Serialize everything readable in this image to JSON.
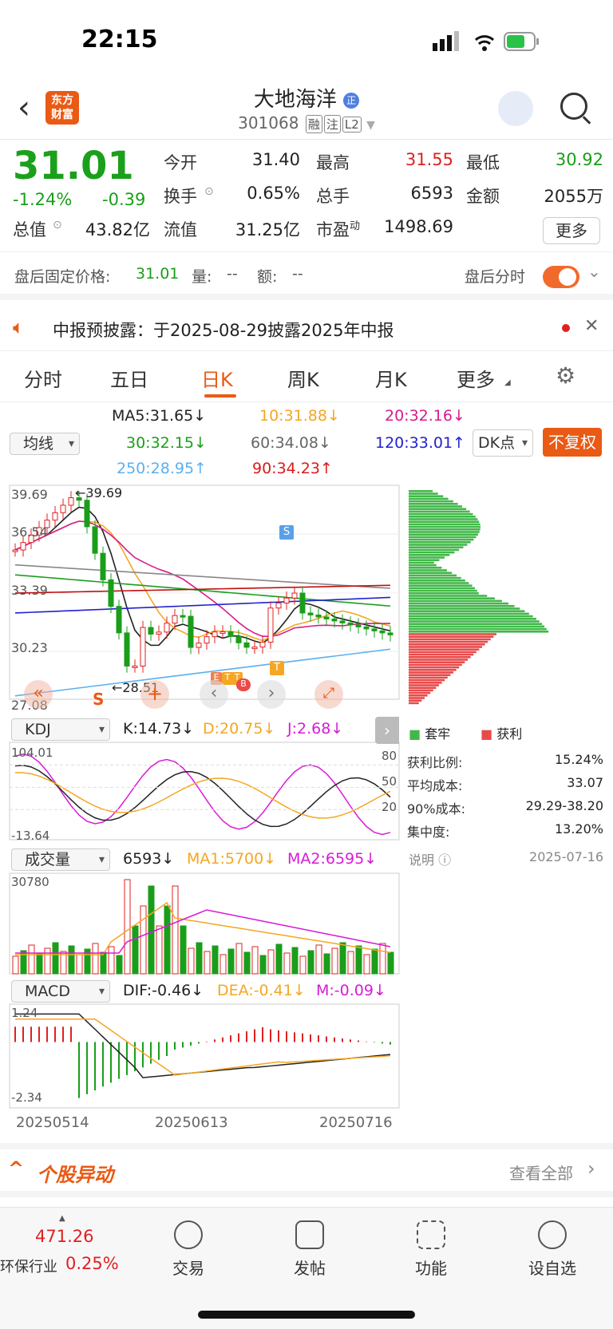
{
  "status": {
    "time": "22:15"
  },
  "header": {
    "logo_text": "东方\n财富",
    "stock_name": "大地海洋",
    "name_badge": "正",
    "code": "301068",
    "tags": [
      "融",
      "注",
      "L2"
    ]
  },
  "quote": {
    "price": "31.01",
    "change_pct": "-1.24%",
    "change": "-0.39",
    "open_label": "今开",
    "open": "31.40",
    "high_label": "最高",
    "high": "31.55",
    "low_label": "最低",
    "low": "30.92",
    "turnover_label": "换手",
    "turnover": "0.65%",
    "volume_label": "总手",
    "volume": "6593",
    "amount_label": "金额",
    "amount": "2055万",
    "mktcap_label": "总值",
    "mktcap": "43.82亿",
    "float_label": "流值",
    "float": "31.25亿",
    "pe_label": "市盈",
    "pe_sup": "动",
    "pe": "1498.69",
    "more_label": "更多"
  },
  "after_hours": {
    "fixed_label": "盘后固定价格:",
    "fixed_value": "31.01",
    "vol_label": "量:",
    "vol_value": "--",
    "amt_label": "额:",
    "amt_value": "--",
    "switch_label": "盘后分时"
  },
  "notice": {
    "text": "中报预披露：于2025-08-29披露2025年中报"
  },
  "tabs": [
    "分时",
    "五日",
    "日K",
    "周K",
    "月K",
    "更多"
  ],
  "ma": {
    "selector": "均线",
    "ma5": "MA5:31.65↓",
    "ma10": "10:31.88↓",
    "ma20": "20:32.16↓",
    "ma30": "30:32.15↓",
    "ma60": "60:34.08↓",
    "ma120": "120:33.01↑",
    "ma250": "250:28.95↑",
    "ma90": "90:34.23↑",
    "dk_label": "DK点",
    "fq_label": "不复权"
  },
  "kline": {
    "y_labels": [
      "39.69",
      "36.54",
      "33.39",
      "30.23",
      "27.08"
    ],
    "high_note": "39.69",
    "low_note": "28.51",
    "signal_s": "S",
    "signal_t": "T",
    "markers": [
      "E",
      "T",
      "T",
      "B"
    ]
  },
  "chips": {
    "legend_trapped": "套牢",
    "legend_profit": "获利",
    "rows": [
      {
        "label": "获利比例:",
        "value": "15.24%"
      },
      {
        "label": "平均成本:",
        "value": "33.07"
      },
      {
        "label": "90%成本:",
        "value": "29.29-38.20"
      },
      {
        "label": "集中度:",
        "value": "13.20%"
      }
    ],
    "note_label": "说明",
    "date": "2025-07-16"
  },
  "kdj": {
    "selector": "KDJ",
    "k": "K:14.73↓",
    "d": "D:20.75↓",
    "j": "J:2.68↓",
    "y_top": "104.01",
    "y_bottom": "-13.64",
    "levels": [
      "80",
      "50",
      "20"
    ]
  },
  "vol": {
    "selector": "成交量",
    "value": "6593↓",
    "ma1": "MA1:5700↓",
    "ma2": "MA2:6595↓",
    "y_top": "30780"
  },
  "macd": {
    "selector": "MACD",
    "dif": "DIF:-0.46↓",
    "dea": "DEA:-0.41↓",
    "m": "M:-0.09↓",
    "y_top": "1.24",
    "y_bottom": "-2.34"
  },
  "dates": [
    "20250514",
    "20250613",
    "20250716"
  ],
  "movement": {
    "title": "个股异动",
    "link": "查看全部"
  },
  "bottom": {
    "index_value": "471.26",
    "index_name": "环保行业",
    "index_change": "0.25%",
    "items": [
      "交易",
      "发帖",
      "功能",
      "设自选"
    ]
  },
  "colors": {
    "up": "#e02020",
    "down": "#1a9e1a",
    "accent": "#ea5a14"
  }
}
